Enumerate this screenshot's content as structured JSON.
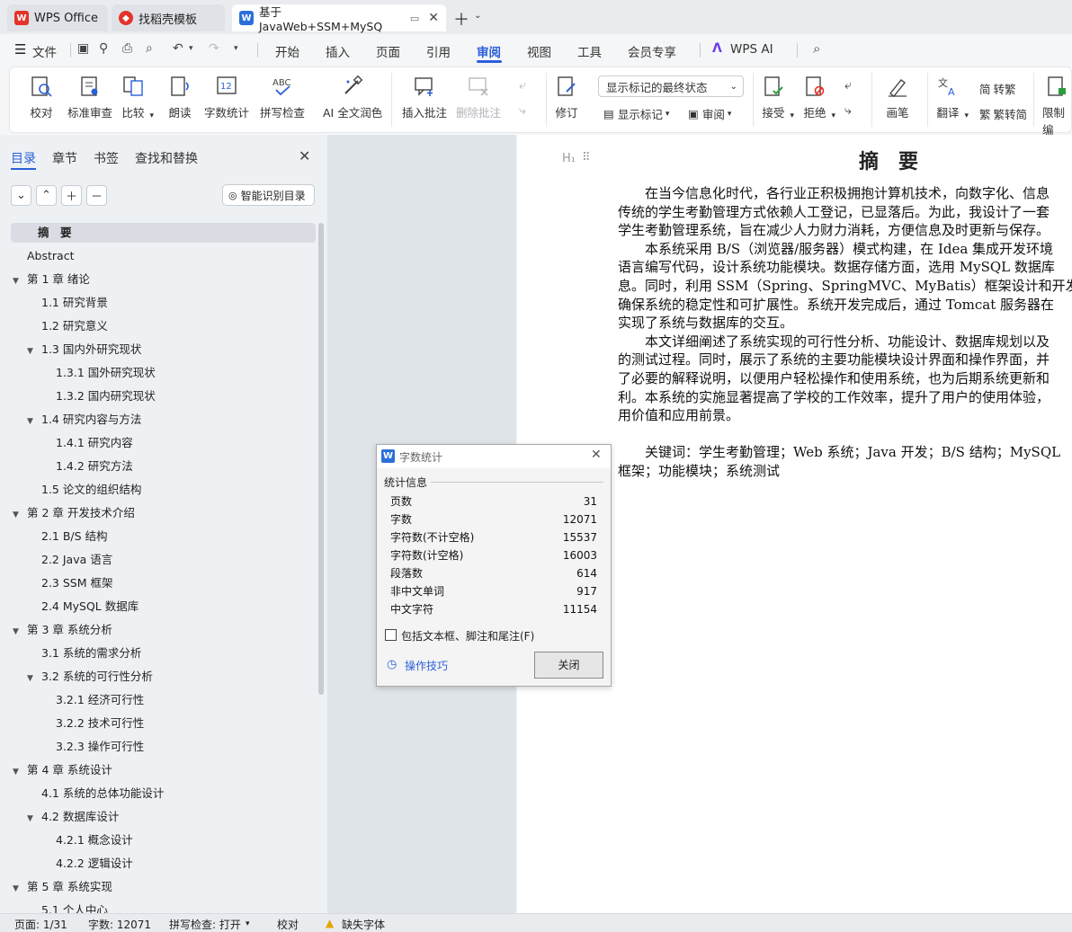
{
  "tabs": [
    {
      "label": "WPS Office",
      "icon": "wps-logo-icon"
    },
    {
      "label": "找稻壳模板",
      "icon": "docer-logo-icon"
    },
    {
      "label": "基于JavaWeb+SSM+MySQ",
      "icon": "word-doc-icon"
    }
  ],
  "menu": {
    "file": "文件",
    "items": [
      "开始",
      "插入",
      "页面",
      "引用",
      "审阅",
      "视图",
      "工具",
      "会员专享"
    ],
    "active": "审阅",
    "ai": "WPS AI"
  },
  "ribbon": {
    "proofread": "校对",
    "standard_review": "标准审查",
    "compare": "比较",
    "read_aloud": "朗读",
    "word_count": "字数统计",
    "spell_check": "拼写检查",
    "ai_polish": "AI 全文润色",
    "insert_comment": "插入批注",
    "delete_comment": "删除批注",
    "track_mode": "显示标记的最终状态",
    "revise": "修订",
    "show_markup": "显示标记",
    "review": "审阅",
    "accept": "接受",
    "reject": "拒绝",
    "pen": "画笔",
    "translate": "翻译",
    "to_traditional": "转繁",
    "to_simplified": "繁转简",
    "restrict": "限制编"
  },
  "nav": {
    "tabs": [
      "目录",
      "章节",
      "书签",
      "查找和替换"
    ],
    "smart_toc": "智能识别目录",
    "toc": [
      {
        "label": "摘　要",
        "level": 0,
        "expand": false,
        "selected": true
      },
      {
        "label": "Abstract",
        "level": 0,
        "expand": false
      },
      {
        "label": "第 1 章  绪论",
        "level": 0,
        "expand": true
      },
      {
        "label": "1.1 研究背景",
        "level": 1,
        "expand": false
      },
      {
        "label": "1.2 研究意义",
        "level": 1,
        "expand": false
      },
      {
        "label": "1.3 国内外研究现状",
        "level": 1,
        "expand": true
      },
      {
        "label": "1.3.1 国外研究现状",
        "level": 2,
        "expand": false
      },
      {
        "label": "1.3.2 国内研究现状",
        "level": 2,
        "expand": false
      },
      {
        "label": "1.4 研究内容与方法",
        "level": 1,
        "expand": true
      },
      {
        "label": "1.4.1 研究内容",
        "level": 2,
        "expand": false
      },
      {
        "label": "1.4.2 研究方法",
        "level": 2,
        "expand": false
      },
      {
        "label": "1.5 论文的组织结构",
        "level": 1,
        "expand": false
      },
      {
        "label": "第 2 章  开发技术介绍",
        "level": 0,
        "expand": true
      },
      {
        "label": "2.1 B/S 结构",
        "level": 1,
        "expand": false
      },
      {
        "label": "2.2 Java 语言",
        "level": 1,
        "expand": false
      },
      {
        "label": "2.3 SSM 框架",
        "level": 1,
        "expand": false
      },
      {
        "label": "2.4 MySQL 数据库",
        "level": 1,
        "expand": false
      },
      {
        "label": "第 3 章  系统分析",
        "level": 0,
        "expand": true
      },
      {
        "label": "3.1 系统的需求分析",
        "level": 1,
        "expand": false
      },
      {
        "label": "3.2 系统的可行性分析",
        "level": 1,
        "expand": true
      },
      {
        "label": "3.2.1 经济可行性",
        "level": 2,
        "expand": false
      },
      {
        "label": "3.2.2 技术可行性",
        "level": 2,
        "expand": false
      },
      {
        "label": "3.2.3 操作可行性",
        "level": 2,
        "expand": false
      },
      {
        "label": "第 4 章  系统设计",
        "level": 0,
        "expand": true
      },
      {
        "label": "4.1 系统的总体功能设计",
        "level": 1,
        "expand": false
      },
      {
        "label": "4.2 数据库设计",
        "level": 1,
        "expand": true
      },
      {
        "label": "4.2.1 概念设计",
        "level": 2,
        "expand": false
      },
      {
        "label": "4.2.2 逻辑设计",
        "level": 2,
        "expand": false
      },
      {
        "label": "第 5 章  系统实现",
        "level": 0,
        "expand": true
      },
      {
        "label": "5.1 个人中心",
        "level": 1,
        "expand": false
      }
    ]
  },
  "document": {
    "title": "摘　要",
    "lines": [
      "　　在当今信息化时代，各行业正积极拥抱计算机技术，向数字化、信息",
      "传统的学生考勤管理方式依赖人工登记，已显落后。为此，我设计了一套",
      "学生考勤管理系统，旨在减少人力财力消耗，方便信息及时更新与保存。",
      "　　本系统采用 B/S（浏览器/服务器）模式构建，在 Idea 集成开发环境",
      "语言编写代码，设计系统功能模块。数据存储方面，选用 MySQL 数据库",
      "息。同时，利用 SSM（Spring、SpringMVC、MyBatis）框架设计和开发系",
      "确保系统的稳定性和可扩展性。系统开发完成后，通过 Tomcat 服务器在",
      "实现了系统与数据库的交互。",
      "　　本文详细阐述了系统实现的可行性分析、功能设计、数据库规划以及",
      "的测试过程。同时，展示了系统的主要功能模块设计界面和操作界面，并",
      "了必要的解释说明，以便用户轻松操作和使用系统，也为后期系统更新和",
      "利。本系统的实施显著提高了学校的工作效率，提升了用户的使用体验，",
      "用价值和应用前景。",
      "",
      "　　关键词：学生考勤管理；Web 系统；Java 开发；B/S 结构；MySQL",
      "框架；功能模块；系统测试"
    ]
  },
  "dialog": {
    "title": "字数统计",
    "section": "统计信息",
    "stats": [
      {
        "label": "页数",
        "value": "31"
      },
      {
        "label": "字数",
        "value": "12071"
      },
      {
        "label": "字符数(不计空格)",
        "value": "15537"
      },
      {
        "label": "字符数(计空格)",
        "value": "16003"
      },
      {
        "label": "段落数",
        "value": "614"
      },
      {
        "label": "非中文单词",
        "value": "917"
      },
      {
        "label": "中文字符",
        "value": "11154"
      }
    ],
    "include_label": "包括文本框、脚注和尾注(F)",
    "tips": "操作技巧",
    "close": "关闭"
  },
  "status": {
    "page": "页面: 1/31",
    "words": "字数: 12071",
    "spell": "拼写检查: 打开",
    "proof": "校对",
    "missing_font": "缺失字体"
  },
  "colors": {
    "accent": "#2b5fd9",
    "wps_red": "#e4332a",
    "word_blue": "#2a6fdb"
  }
}
